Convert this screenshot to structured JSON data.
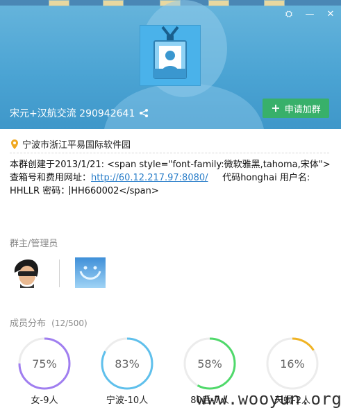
{
  "window": {
    "controls": [
      "⛭",
      "—",
      "✕"
    ]
  },
  "header": {
    "group_name": "宋元+汉航交流 290942641",
    "join_label": "申请加群",
    "join_plus": "+"
  },
  "location": {
    "text": "宁波市浙江平易国际软件园"
  },
  "description": {
    "line1": "本群创建于2013/1/21:  <span style=\"font-family:微软雅黑,tahoma,宋体\">",
    "line2_prefix": "查箱号和费用网址：",
    "link": "http://60.12.217.97:8080/",
    "line2_suffix": "     代码honghai 用户名:",
    "line3_prefix": "HHLLR 密码：",
    "line3_value": "HH660002</span>"
  },
  "admins": {
    "title": "群主/管理员"
  },
  "members": {
    "title": "成员分布",
    "count": "(12/500)",
    "stats": [
      {
        "value": "75%",
        "label": "女-9人",
        "percent": 75,
        "color": "#a07ef0"
      },
      {
        "value": "83%",
        "label": "宁波-10人",
        "percent": 83,
        "color": "#5fc0ec"
      },
      {
        "value": "58%",
        "label": "80后-7人",
        "percent": 58,
        "color": "#4fd96a"
      },
      {
        "value": "16%",
        "label": "天蝎-2人",
        "percent": 16,
        "color": "#f0b323"
      }
    ]
  },
  "watermark": {
    "text": "www.wooyun.org"
  }
}
